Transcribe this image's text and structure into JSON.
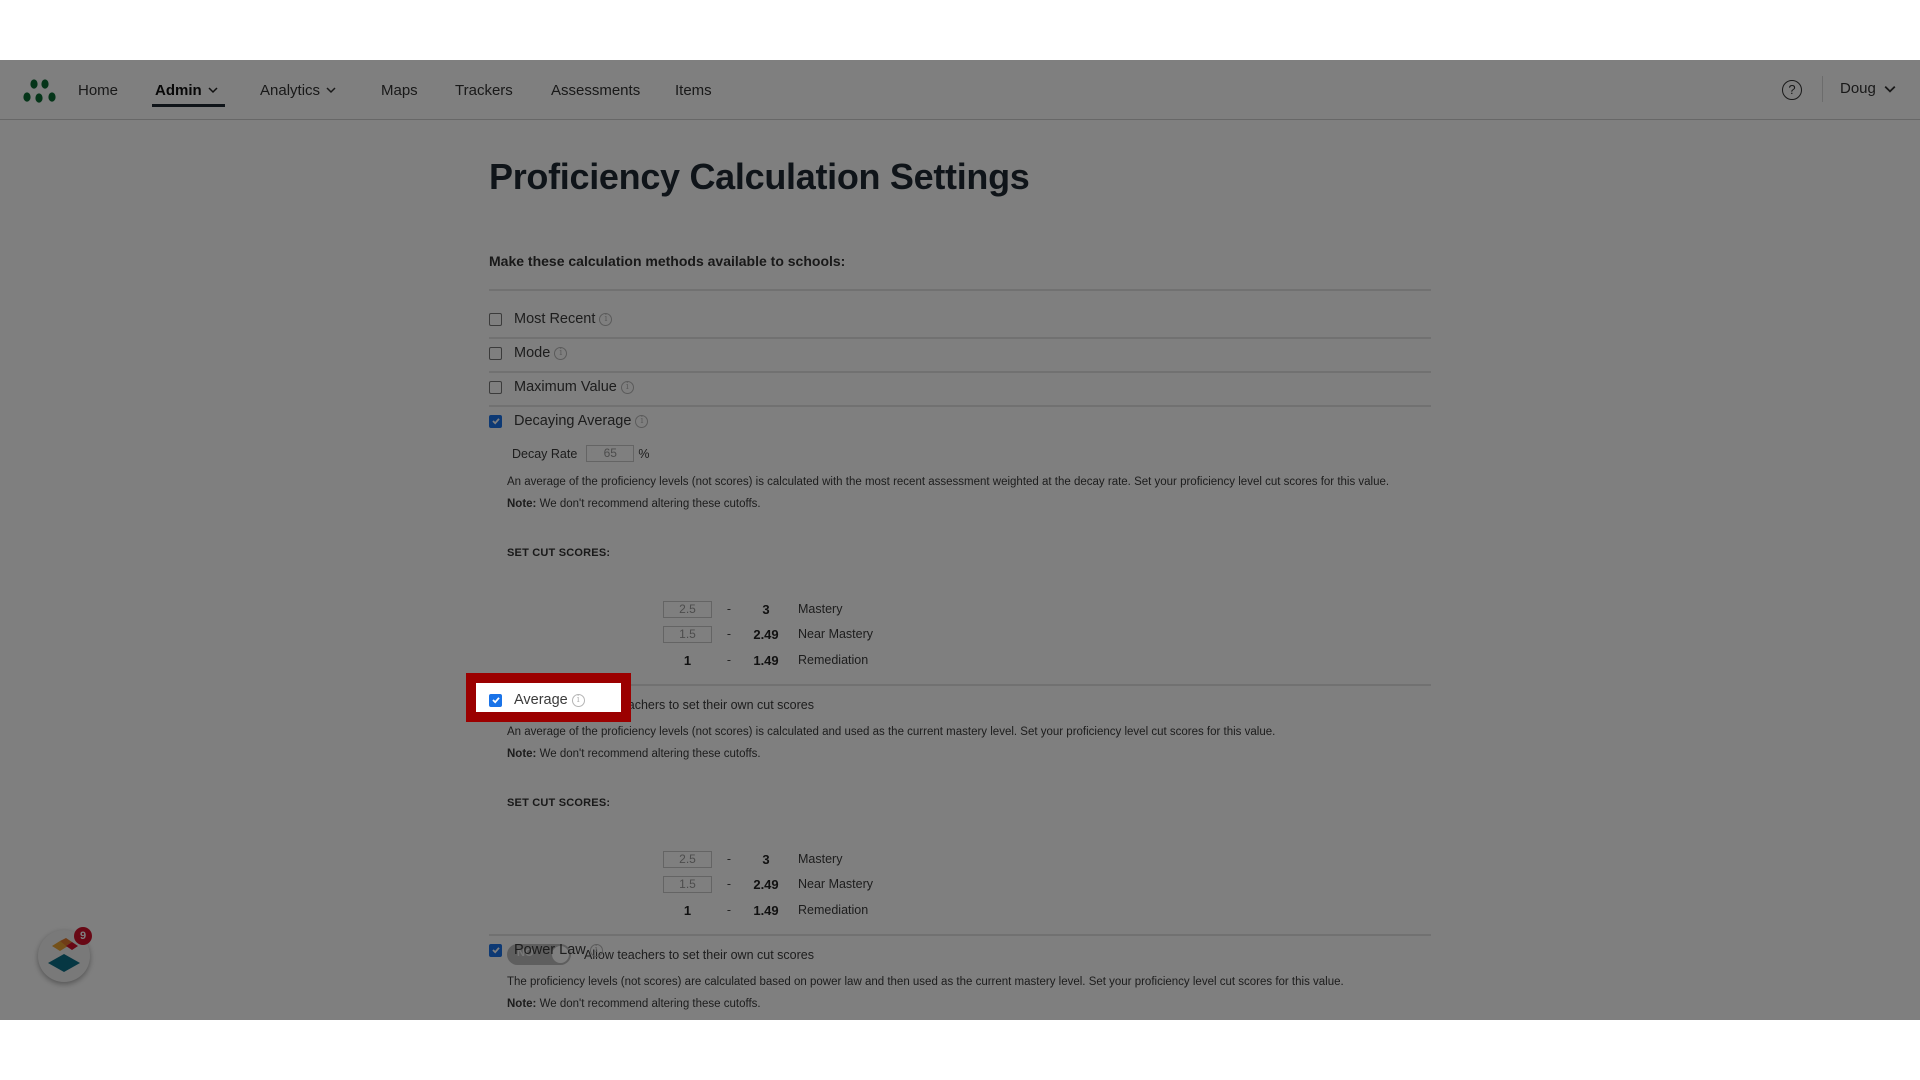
{
  "nav": {
    "logo": "school-logo",
    "items": [
      {
        "label": "Home",
        "has_dropdown": false,
        "active": false
      },
      {
        "label": "Admin",
        "has_dropdown": true,
        "active": true
      },
      {
        "label": "Analytics",
        "has_dropdown": true,
        "active": false
      },
      {
        "label": "Maps",
        "has_dropdown": false,
        "active": false
      },
      {
        "label": "Trackers",
        "has_dropdown": false,
        "active": false
      },
      {
        "label": "Assessments",
        "has_dropdown": false,
        "active": false
      },
      {
        "label": "Items",
        "has_dropdown": false,
        "active": false
      }
    ],
    "help_icon": "?",
    "user": "Doug"
  },
  "page": {
    "title": "Proficiency Calculation Settings",
    "subtitle": "Make these calculation methods available to schools:"
  },
  "methods": [
    {
      "label": "Most Recent",
      "checked": false
    },
    {
      "label": "Mode",
      "checked": false
    },
    {
      "label": "Maximum Value",
      "checked": false
    },
    {
      "label": "Decaying Average",
      "checked": true,
      "decay_rate_label": "Decay Rate",
      "decay_rate_value": "65",
      "decay_rate_unit": "%",
      "description": "An average of the proficiency levels (not scores) is calculated with the most recent assessment weighted at the decay rate. Set your proficiency level cut scores for this value.",
      "note_label": "Note:",
      "note_text": " We don't recommend altering these cutoffs.",
      "cut_scores_label": "SET CUT SCORES:",
      "cut_scores": [
        {
          "low": "2.5",
          "separator": "-",
          "high": "3",
          "level": "Mastery",
          "editable": true
        },
        {
          "low": "1.5",
          "separator": "-",
          "high": "2.49",
          "level": "Near Mastery",
          "editable": true
        },
        {
          "low": "1",
          "separator": "-",
          "high": "1.49",
          "level": "Remediation",
          "editable": false
        }
      ],
      "toggle_state": "NO",
      "toggle_label": "Allow teachers to set their own cut scores"
    },
    {
      "label": "Average",
      "checked": true,
      "highlighted": true,
      "description": "An average of the proficiency levels (not scores) is calculated and used as the current mastery level. Set your proficiency level cut scores for this value.",
      "note_label": "Note:",
      "note_text": " We don't recommend altering these cutoffs.",
      "cut_scores_label": "SET CUT SCORES:",
      "cut_scores": [
        {
          "low": "2.5",
          "separator": "-",
          "high": "3",
          "level": "Mastery",
          "editable": true
        },
        {
          "low": "1.5",
          "separator": "-",
          "high": "2.49",
          "level": "Near Mastery",
          "editable": true
        },
        {
          "low": "1",
          "separator": "-",
          "high": "1.49",
          "level": "Remediation",
          "editable": false
        }
      ],
      "toggle_state": "NO",
      "toggle_label": "Allow teachers to set their own cut scores"
    },
    {
      "label": "Power Law",
      "checked": true,
      "description": "The proficiency levels (not scores) are calculated based on power law and then used as the current mastery level. Set your proficiency level cut scores for this value.",
      "note_label": "Note:",
      "note_text": " We don't recommend altering these cutoffs."
    }
  ],
  "widget": {
    "badge_count": "9"
  },
  "colors": {
    "highlight": "#9b0000",
    "checkbox": "#1a73e8",
    "logo_green": "#0a6b32",
    "badge": "#d0102b"
  }
}
